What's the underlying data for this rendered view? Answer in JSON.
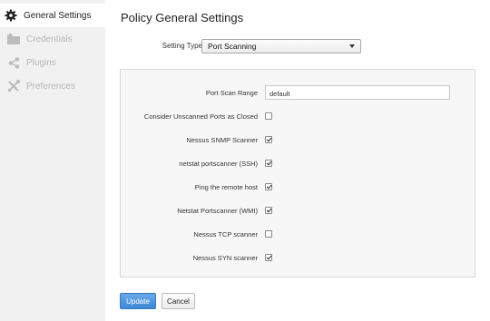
{
  "sidebar": {
    "items": [
      {
        "label": "General Settings",
        "icon": "gear-icon",
        "active": true
      },
      {
        "label": "Credentials",
        "icon": "folder-icon",
        "active": false
      },
      {
        "label": "Plugins",
        "icon": "share-nodes-icon",
        "active": false
      },
      {
        "label": "Preferences",
        "icon": "tools-icon",
        "active": false
      }
    ]
  },
  "main": {
    "title": "Policy General Settings",
    "setting_type": {
      "label": "Setting Type",
      "value": "Port Scanning"
    },
    "fields": [
      {
        "label": "Port Scan Range",
        "type": "text",
        "value": "default"
      },
      {
        "label": "Consider Unscanned Ports as Closed",
        "type": "checkbox",
        "checked": false
      },
      {
        "label": "Nessus SNMP Scanner",
        "type": "checkbox",
        "checked": true
      },
      {
        "label": "netstat portscanner (SSH)",
        "type": "checkbox",
        "checked": true
      },
      {
        "label": "Ping the remote host",
        "type": "checkbox",
        "checked": true
      },
      {
        "label": "Netstat Portscanner (WMI)",
        "type": "checkbox",
        "checked": true
      },
      {
        "label": "Nessus TCP scanner",
        "type": "checkbox",
        "checked": false
      },
      {
        "label": "Nessus SYN scanner",
        "type": "checkbox",
        "checked": true
      }
    ],
    "buttons": {
      "update": "Update",
      "cancel": "Cancel"
    }
  },
  "colors": {
    "accent": "#4a90d9",
    "sidebar_bg": "#f1f1f1",
    "panel_bg": "#f7f7f7"
  }
}
